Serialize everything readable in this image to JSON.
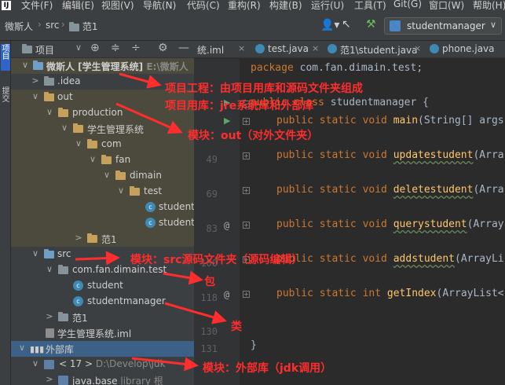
{
  "menubar": {
    "items": [
      "文件(F)",
      "编辑(E)",
      "视图(V)",
      "导航(N)",
      "代码(C)",
      "重构(R)",
      "构建(B)",
      "运行(U)",
      "工具(T)",
      "Git(G)",
      "窗口(W)",
      "帮助(H)"
    ]
  },
  "breadcrumbs": {
    "project": "微斯人",
    "src": "src",
    "pkg": "范1"
  },
  "run_config": {
    "label": "studentmanager"
  },
  "stripe": {
    "project_tab": "项目",
    "commit_tab": "提交"
  },
  "project_panel": {
    "title": "项目"
  },
  "tree": [
    {
      "label": "微斯人 [学生管理系统]",
      "extra": "E:\\微斯人",
      "bold": true,
      "chev": "∨"
    },
    {
      "label": ".idea",
      "chev": ">"
    },
    {
      "label": "out",
      "chev": "∨"
    },
    {
      "label": "production",
      "chev": "∨"
    },
    {
      "label": "学生管理系统",
      "chev": "∨"
    },
    {
      "label": "com",
      "chev": "∨"
    },
    {
      "label": "fan",
      "chev": "∨"
    },
    {
      "label": "dimain",
      "chev": "∨"
    },
    {
      "label": "test",
      "chev": "∨"
    },
    {
      "label": "student",
      "chev": ""
    },
    {
      "label": "studentmanager",
      "chev": ""
    },
    {
      "label": "范1",
      "chev": ">"
    },
    {
      "label": "src",
      "chev": "∨"
    },
    {
      "label": "com.fan.dimain.test",
      "chev": "∨"
    },
    {
      "label": "student",
      "chev": ""
    },
    {
      "label": "studentmanager",
      "chev": ""
    },
    {
      "label": "范1",
      "chev": ">"
    },
    {
      "label": "学生管理系统.iml",
      "chev": ""
    },
    {
      "label": "外部库",
      "chev": "∨"
    },
    {
      "label": "< 17 >",
      "extra": "D:\\Develop\\jdk",
      "chev": "∨"
    },
    {
      "label": "java.base",
      "extra": "library 根",
      "chev": ">"
    }
  ],
  "tabs": [
    {
      "label": "统.iml"
    },
    {
      "label": "test.java"
    },
    {
      "label": "范1\\student.java"
    },
    {
      "label": "phone.java"
    }
  ],
  "line_numbers": [
    "",
    "",
    "",
    "",
    "49",
    "",
    "69",
    "",
    "83",
    "",
    "100",
    "",
    "118",
    "",
    "130",
    "131"
  ],
  "code": {
    "l1_kw": "package",
    "l1_rest": " com.fan.dimain.test;",
    "l3_kw": "public class",
    "l3_cls": "studentmanager",
    "l3_rest": " {",
    "l4_kw": "public static void",
    "l4_fn": "main",
    "l4_rest": "(String[] args",
    "l5_kw": "public static void",
    "l5_fn": "updatestudent",
    "l5_rest": "(Arra",
    "l6_kw": "public static void",
    "l6_fn": "deletestudent",
    "l6_rest": "(Arra",
    "l7_kw": "public static void",
    "l7_fn": "querystudent",
    "l7_rest": "(Array",
    "l8_kw": "public static void",
    "l8_fn": "addstudent",
    "l8_rest": "(ArrayLi",
    "l9_kw": "public static int",
    "l9_fn": "getIndex",
    "l9_rest": "(ArrayList<",
    "l10": "}"
  },
  "annotations": {
    "a1": "项目工程：由项目用库和源码文件夹组成",
    "a2": "项目用库：jre系统库和外部库",
    "a3": "模块：out（对外文件夹）",
    "a4": "模块：src源码文件夹（源码编辑）",
    "a5": "包",
    "a6": "类",
    "a7": "模块：外部库（jdk调用）"
  },
  "colors": {
    "annotation": "#ff2d2d",
    "keyword": "#cc7832",
    "function": "#ffc66d",
    "text": "#a9b7c6"
  }
}
